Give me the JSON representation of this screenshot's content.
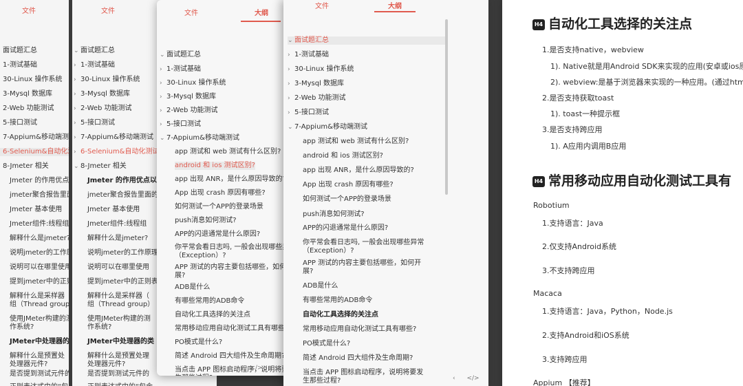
{
  "tabs": {
    "file": "文件",
    "outline": "大纲"
  },
  "panel1": {
    "items": [
      "面试题汇总",
      "1-测试基础",
      "30-Linux 操作系统",
      "3-Mysql 数据库",
      "2-Web 功能测试",
      "5-接口测试",
      "7-Appium&移动端测试",
      "6-Selenium&自动化测试",
      "8-Jmeter 相关",
      "Jmeter 的作用优点",
      "jmeter聚合报告里面的",
      "Jmeter 基本使用",
      "Jmeter组件:线程组",
      "解释什么是jmeter?",
      "说明jmeter的工作原理",
      "说明可以在哪里使用",
      "提到jmeter中的正则",
      "解释什么是采样器",
      "组（Thread group）",
      "使用JMeter构建的测",
      "作系统?",
      "JMeter中处理器的类",
      "解释什么是预置处",
      "处理器元件?",
      "是否提到测试元件的",
      "正则表达式中的“包",
      "么?"
    ]
  },
  "panel2": {
    "items": [
      "面试题汇总",
      "1-测试基础",
      "30-Linux 操作系统",
      "3-Mysql 数据库",
      "2-Web 功能测试",
      "5-接口测试",
      "7-Appium&移动端测试",
      "6-Selenium&自动化测试",
      "8-Jmeter 相关",
      "Jmeter 的作用优点以",
      "jmeter聚合报告里面的",
      "Jmeter 基本使用",
      "Jmeter组件:线程组",
      "解释什么是jmeter?",
      "说明jmeter的工作原理",
      "说明可以在哪里使用",
      "提到jmeter中的正则表",
      "解释什么是采样器（",
      "组（Thread group）",
      "使用JMeter构建的测",
      "作系统?",
      "JMeter中处理器的类",
      "解释什么是预置处理",
      "处理器元件?",
      "是否提到测试元件的",
      "正则表达式中的“包含",
      "么?"
    ]
  },
  "panel3": {
    "items": [
      "面试题汇总",
      "1-测试基础",
      "30-Linux 操作系统",
      "3-Mysql 数据库",
      "2-Web 功能测试",
      "5-接口测试",
      "7-Appium&移动端测试",
      "app 测试和 web 测试有什么区别?",
      "android 和 ios 测试区别?",
      "app 出现 ANR，是什么原因导致的?",
      "App 出现 crash 原因有哪些?",
      "如何测试一个APP的登录场景",
      "push消息如何测试?",
      "APP的闪退通常是什么原因?",
      "你平常会看日志吗, 一般会出现哪些异常",
      "（Exception）?",
      "APP 测试的内容主要包括哪些，如何开",
      "展?",
      "ADB是什么",
      "有哪些常用的ADB命令",
      "自动化工具选择的关注点",
      "常用移动应用自动化测试工具有哪些?",
      "PO模式是什么?",
      "简述 Android 四大组件及生命周期?",
      "当点击 APP 图标启动程序，说明将要发",
      "生那些过程?",
      "APP 测试的内容主要包括哪些，如何开"
    ],
    "nav_prev": "‹",
    "nav_code": "</>"
  },
  "panel4": {
    "items": [
      "面试题汇总",
      "1-测试基础",
      "30-Linux 操作系统",
      "3-Mysql 数据库",
      "2-Web 功能测试",
      "5-接口测试",
      "7-Appium&移动端测试",
      "app 测试和 web 测试有什么区别?",
      "android 和 ios 测试区别?",
      "app 出现 ANR，是什么原因导致的?",
      "App 出现 crash 原因有哪些?",
      "如何测试一个APP的登录场景",
      "push消息如何测试?",
      "APP的闪退通常是什么原因?",
      "你平常会看日志吗, 一般会出现哪些异常",
      "（Exception）?",
      "APP 测试的内容主要包括哪些，如何开",
      "展?",
      "ADB是什么",
      "有哪些常用的ADB命令",
      "自动化工具选择的关注点",
      "常用移动应用自动化测试工具有哪些?",
      "PO模式是什么?",
      "简述 Android 四大组件及生命周期?",
      "当点击 APP 图标启动程序，说明将要发",
      "生那些过程?",
      "APP 测试的内容主要包括哪些，如何开"
    ],
    "nav_prev": "‹",
    "nav_code": "</>"
  },
  "doc": {
    "h4_badge": "H4",
    "heading1": "自动化工具选择的关注点",
    "list1": [
      "1.是否支持native，webview",
      "1). Native就是用Android SDK来实现的应用(安卓或ios原",
      "2). webview:是基于浏览器来实现的一种应用。(通过htm",
      "2.是否支持获取toast",
      "1). toast一种提示框",
      "3.是否支持跨应用",
      "1). A应用内调用B应用"
    ],
    "heading2": "常用移动应用自动化测试工具有",
    "tools": [
      "Robotium",
      "1.支持语言：Java",
      "2.仅支持Android系统",
      "3.不支持跨应用",
      "Macaca",
      "1.支持语言：Java，Python，Node.js",
      "2.支持Android和iOS系统",
      "3.支持跨应用",
      "Appium 【推荐】"
    ]
  },
  "colors": {
    "accent": "#e05a4e",
    "panel_bg": "#f5f5f5",
    "doc_bg": "#ffffff"
  }
}
